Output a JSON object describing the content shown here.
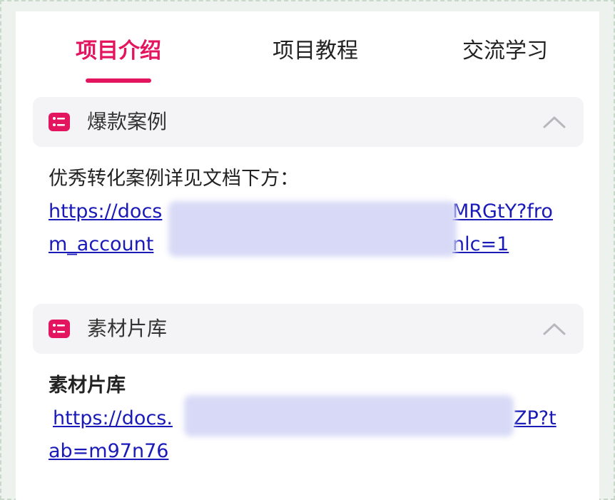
{
  "tabs": [
    {
      "label": "项目介绍",
      "active": true
    },
    {
      "label": "项目教程",
      "active": false
    },
    {
      "label": "交流学习",
      "active": false
    }
  ],
  "accent_color": "#e3155f",
  "sections": [
    {
      "title": "爆款案例",
      "icon": "list-icon",
      "expanded": true,
      "intro": "优秀转化案例详见文档下方：",
      "link_line1": "https://docs",
      "link_line1_end": "MRGtY?fro",
      "link_line2": "m_account",
      "link_line2_end": "nlc=1"
    },
    {
      "title": "素材片库",
      "icon": "list-icon",
      "expanded": true,
      "label": "素材片库",
      "link_line1": "https://docs.",
      "link_line1_end": "ZP?t",
      "link_line2": "ab=m97n76"
    }
  ]
}
